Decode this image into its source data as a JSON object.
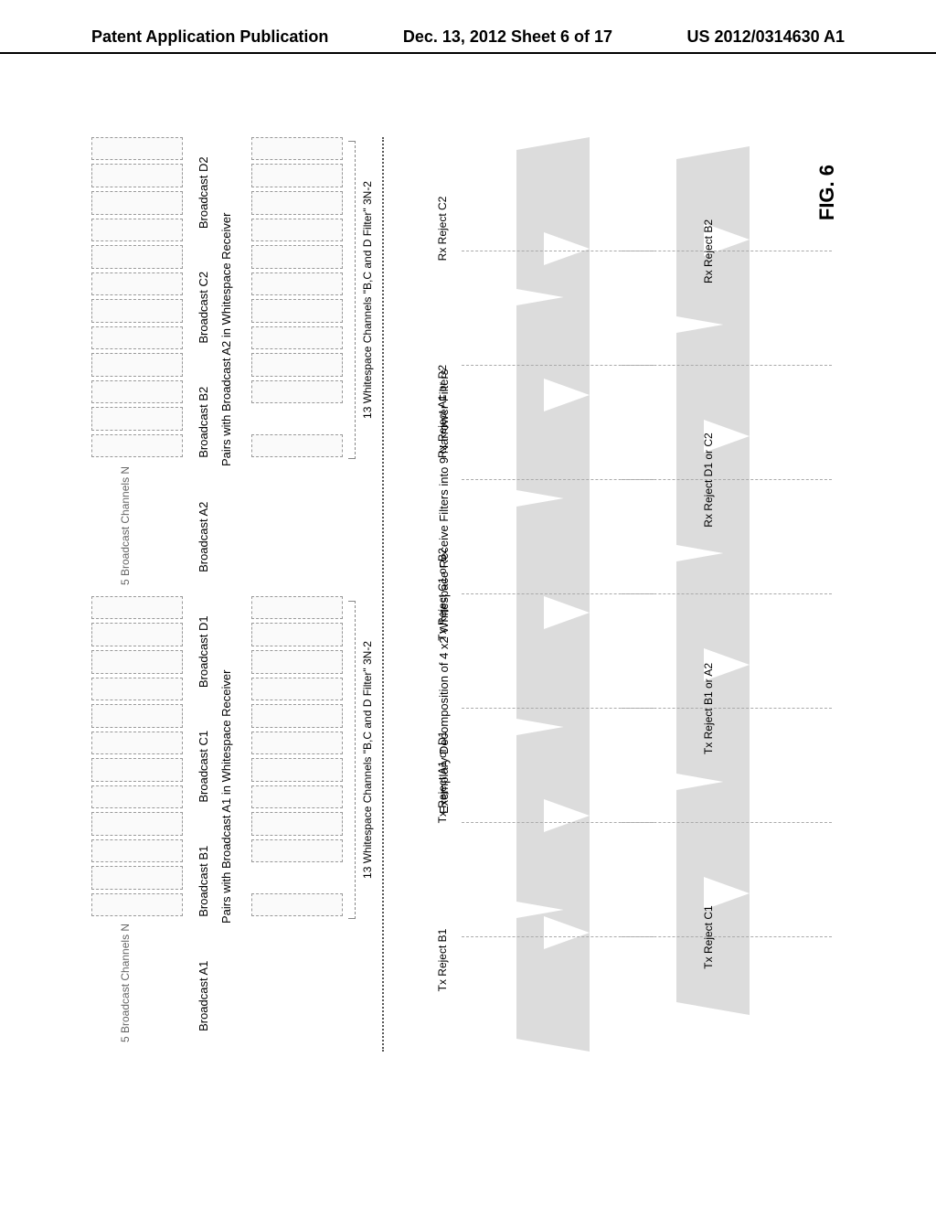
{
  "header": {
    "left": "Patent Application Publication",
    "center": "Dec. 13, 2012  Sheet 6 of 17",
    "right": "US 2012/0314630 A1"
  },
  "figure_label": "FIG. 6",
  "row1": {
    "group1": "5 Broadcast Channels N",
    "group2": "5 Broadcast Channels N"
  },
  "broadcast_labels": [
    "Broadcast A1",
    "Broadcast B1",
    "Broadcast C1",
    "Broadcast D1",
    "Broadcast A2",
    "Broadcast B2",
    "Broadcast C2",
    "Broadcast D2"
  ],
  "row2_left": "Pairs with Broadcast A1 in Whitespace Receiver",
  "row2_right": "Pairs with Broadcast A2 in Whitespace Receiver",
  "row3_caption_left": "13 Whitespace Channels \"B,C and D Filter\" 3N-2",
  "row3_caption_right": "13 Whitespace Channels \"B,C and D Filter\" 3N-2",
  "row5": "Exemplary Decomposition of 4 x2 Whitespace Receive Filters into 9 Narrower Filters",
  "row6_labels": [
    "Tx Reject B1",
    "Tx Reject A1 or D1",
    "Tx Reject C1 or B2",
    "Rx Reject A1 or D2",
    "Rx Reject C2"
  ],
  "row7_labels": [
    "Tx Reject C1",
    "Tx Reject B1 or A2",
    "Rx Reject D1 or C2",
    "Rx Reject B2"
  ]
}
